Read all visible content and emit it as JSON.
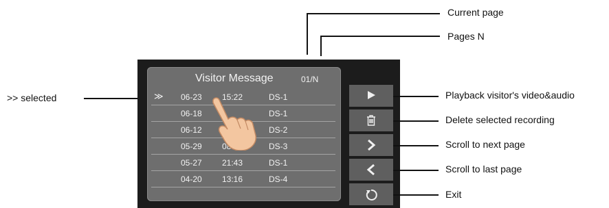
{
  "screen": {
    "title": "Visitor Message",
    "page_indicator": "01/N",
    "rows": [
      {
        "marker": "≫",
        "date": "06-23",
        "time": "15:22",
        "device": "DS-1"
      },
      {
        "marker": "",
        "date": "06-18",
        "time": "",
        "device": "DS-1"
      },
      {
        "marker": "",
        "date": "06-12",
        "time": "1",
        "device": "DS-2"
      },
      {
        "marker": "",
        "date": "05-29",
        "time": "08:39",
        "device": "DS-3"
      },
      {
        "marker": "",
        "date": "05-27",
        "time": "21:43",
        "device": "DS-1"
      },
      {
        "marker": "",
        "date": "04-20",
        "time": "13:16",
        "device": "DS-4"
      }
    ],
    "buttons": [
      {
        "icon": "play-icon"
      },
      {
        "icon": "trash-icon"
      },
      {
        "icon": "chevron-right-icon"
      },
      {
        "icon": "chevron-left-icon"
      },
      {
        "icon": "refresh-icon"
      }
    ]
  },
  "callouts": {
    "current_page": "Current page",
    "pages_n": "Pages N",
    "selected": ">> selected",
    "playback": "Playback visitor's video&audio",
    "delete": "Delete selected recording",
    "next_page": "Scroll to next page",
    "last_page": "Scroll to last page",
    "exit": "Exit"
  },
  "colors": {
    "device_bg": "#1c1c1c",
    "panel_bg": "#6e6e6e",
    "button_bg": "#5f5f5f",
    "text_light": "#f2f2f2",
    "callout_line": "#111111"
  }
}
